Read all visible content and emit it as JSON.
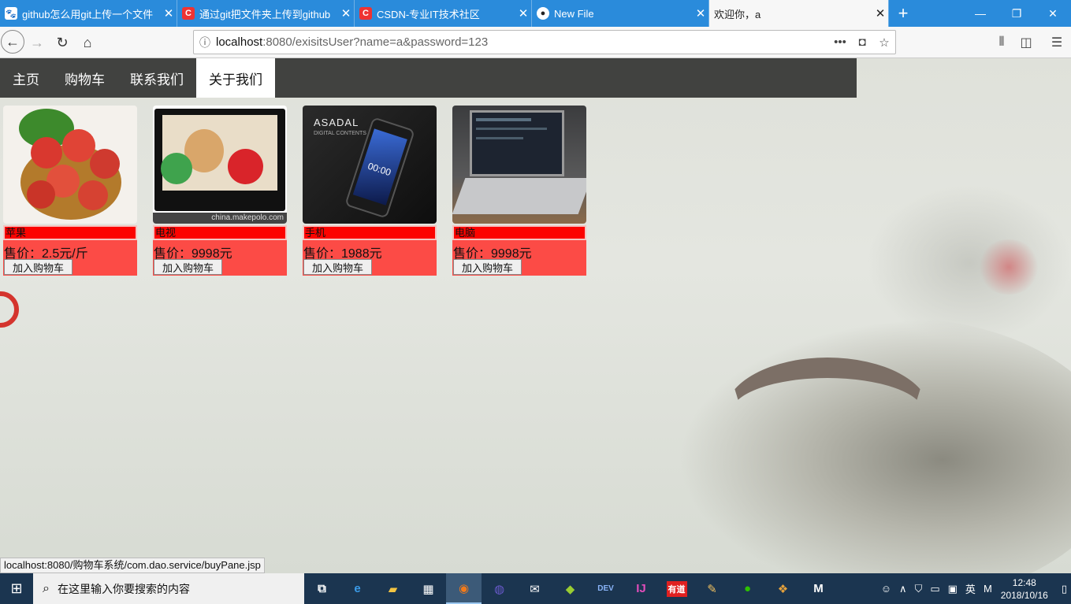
{
  "browser": {
    "tabs": [
      {
        "title": "github怎么用git上传一个文件",
        "icon": "baidu-icon",
        "icon_color": "#2932e1",
        "glyph": "🐾"
      },
      {
        "title": "通过git把文件夹上传到github",
        "icon": "csdn-icon",
        "icon_color": "#e33",
        "glyph": "C"
      },
      {
        "title": "CSDN-专业IT技术社区",
        "icon": "csdn-icon",
        "icon_color": "#e33",
        "glyph": "C"
      },
      {
        "title": "New File",
        "icon": "github-icon",
        "icon_color": "#fff",
        "glyph": "●"
      },
      {
        "title": "欢迎你，a",
        "icon": "",
        "icon_color": "",
        "glyph": ""
      }
    ],
    "active_tab": 4,
    "url_host": "localhost",
    "url_rest": ":8080/exisitsUser?name=a&password=123",
    "status_url": "localhost:8080/购物车系统/com.dao.service/buyPane.jsp"
  },
  "site": {
    "nav": [
      "主页",
      "购物车",
      "联系我们",
      "关于我们"
    ],
    "nav_selected": 3,
    "button_label": "加入购物车",
    "products": [
      {
        "name": "苹果",
        "price": "售价：2.5元/斤",
        "image": "apples-image"
      },
      {
        "name": "电视",
        "price": "售价：9998元",
        "image": "tv-image",
        "watermark": "china.makepolo.com"
      },
      {
        "name": "手机",
        "price": "售价：1988元",
        "image": "phone-image",
        "brand": "ASADAL",
        "brand_sub": "DIGITAL CONTENTS",
        "time": "00:00"
      },
      {
        "name": "电脑",
        "price": "售价：9998元",
        "image": "laptop-image"
      }
    ]
  },
  "taskbar": {
    "search_placeholder": "在这里输入你要搜索的内容",
    "ime": "英",
    "time": "12:48",
    "date": "2018/10/16",
    "apps": [
      "task-view-icon",
      "edge-icon",
      "file-explorer-icon",
      "store-icon",
      "firefox-icon",
      "eclipse-icon",
      "mail-icon",
      "git-icon",
      "devc-icon",
      "intellij-icon",
      "youdao-icon",
      "paint-icon",
      "wechat-icon",
      "app-icon",
      "m-icon"
    ]
  },
  "colors": {
    "tabbar": "#2a8bdb",
    "nav": "#414240",
    "card_name": "#fc0300",
    "card_body": "#fc4b46"
  }
}
